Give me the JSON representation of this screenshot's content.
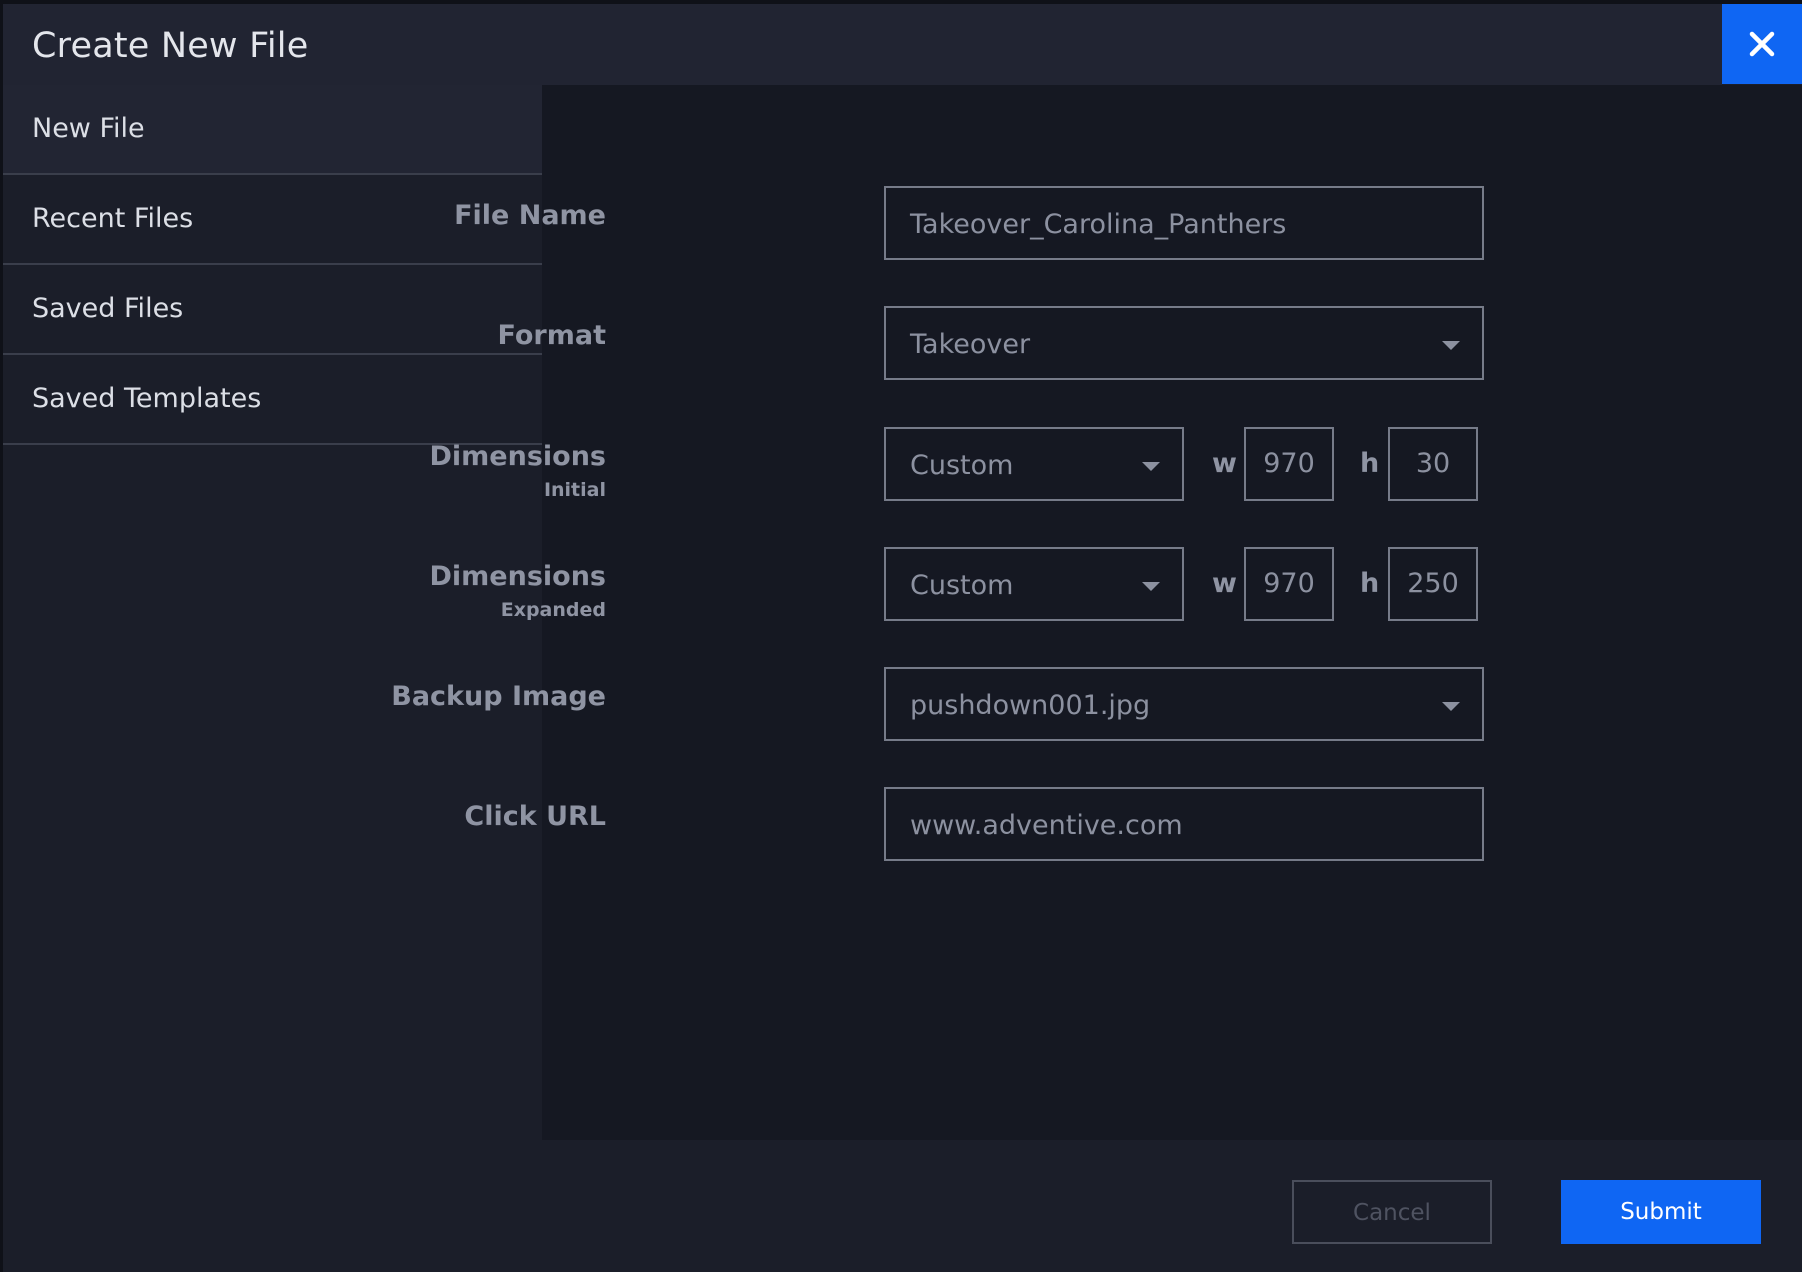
{
  "dialog": {
    "title": "Create New File",
    "close_icon": "close-icon",
    "accent_color": "#0f66f3"
  },
  "sidebar": {
    "items": [
      {
        "label": "New File",
        "active": true
      },
      {
        "label": "Recent Files",
        "active": false
      },
      {
        "label": "Saved Files",
        "active": false
      },
      {
        "label": "Saved Templates",
        "active": false
      }
    ]
  },
  "form": {
    "file_name": {
      "label": "File Name",
      "value": "Takeover_Carolina_Panthers"
    },
    "format": {
      "label": "Format",
      "value": "Takeover"
    },
    "dimensions_initial": {
      "label": "Dimensions",
      "sublabel": "Initial",
      "preset": "Custom",
      "w_label": "w",
      "w": "970",
      "h_label": "h",
      "h": "30"
    },
    "dimensions_expanded": {
      "label": "Dimensions",
      "sublabel": "Expanded",
      "preset": "Custom",
      "w_label": "w",
      "w": "970",
      "h_label": "h",
      "h": "250"
    },
    "backup_image": {
      "label": "Backup Image",
      "value": "pushdown001.jpg"
    },
    "click_url": {
      "label": "Click URL",
      "value": "www.adventive.com"
    }
  },
  "footer": {
    "cancel_label": "Cancel",
    "submit_label": "Submit"
  }
}
